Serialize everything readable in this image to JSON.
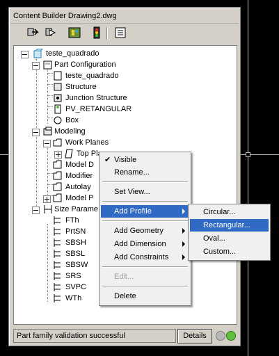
{
  "window": {
    "title": "Content Builder Drawing2.dwg"
  },
  "toolbar": {
    "buttons": [
      {
        "icon": "part-icon"
      },
      {
        "icon": "part-open-icon"
      },
      {
        "icon": "validate-icon"
      },
      {
        "icon": "traffic-light-icon"
      },
      {
        "icon": "list-icon"
      }
    ]
  },
  "tree": {
    "root": "teste_quadrado",
    "part_configuration": "Part Configuration",
    "pc_items": [
      "teste_quadrado",
      "Structure",
      "Junction Structure",
      "PV_RETANGULAR",
      "Box"
    ],
    "modeling": "Modeling",
    "work_planes": "Work Planes",
    "top_plane": "Top Plane",
    "modeling_items": [
      "Model D",
      "Modifier",
      "Autolay",
      "Model P"
    ],
    "size_parameters": "Size Parame",
    "params": [
      "FTh",
      "PrtSN",
      "SBSH",
      "SBSL",
      "SBSW",
      "SRS",
      "SVPC",
      "WTh"
    ]
  },
  "context_menu": {
    "visible": "Visible",
    "rename": "Rename...",
    "set_view": "Set View...",
    "add_profile": "Add Profile",
    "add_geometry": "Add Geometry",
    "add_dimension": "Add Dimension",
    "add_constraints": "Add Constraints",
    "edit": "Edit...",
    "delete": "Delete"
  },
  "submenu": {
    "circular": "Circular...",
    "rectangular": "Rectangular...",
    "oval": "Oval...",
    "custom": "Custom..."
  },
  "status": {
    "text": "Part family validation successful",
    "details_label": "Details"
  },
  "colors": {
    "highlight": "#316ac5",
    "menu_bg": "#f0f0f0",
    "window_bg": "#d4d0c8",
    "led_gray": "#b8b8b8",
    "led_green": "#5fbf3f"
  }
}
